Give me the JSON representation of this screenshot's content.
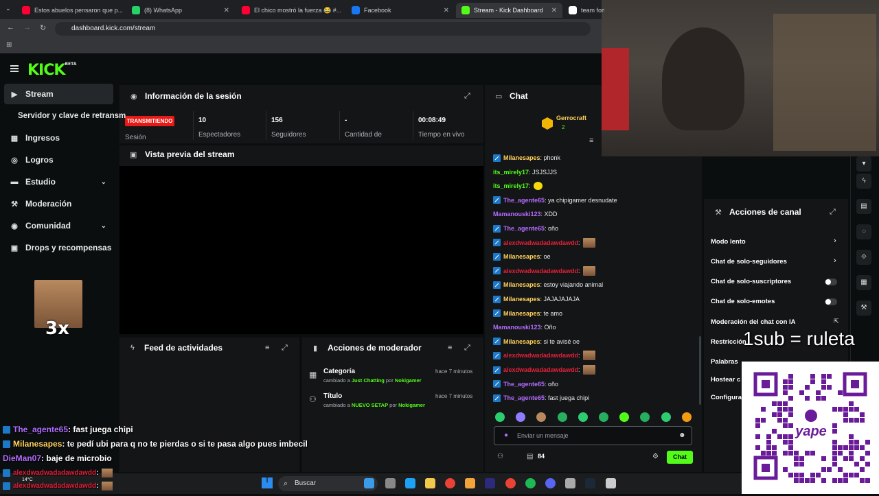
{
  "browser": {
    "tabs": [
      {
        "title": "Estos abuelos pensaron que p...",
        "color": "#ff0033"
      },
      {
        "title": "(8) WhatsApp",
        "color": "#25d366"
      },
      {
        "title": "El chico mostró la fuerza 😂 #...",
        "color": "#ff0033"
      },
      {
        "title": "Facebook",
        "color": "#1877f2"
      },
      {
        "title": "Stream - Kick Dashboard",
        "color": "#53fc18"
      },
      {
        "title": "team fort",
        "color": "#ffffff"
      }
    ],
    "url": "dashboard.kick.com/stream"
  },
  "kick": {
    "logo": "KICK",
    "logo_sup": "BETA"
  },
  "sidebar": {
    "items": [
      {
        "label": "Stream",
        "icon": "play-icon",
        "active": true
      },
      {
        "label": "Servidor y clave de retransm",
        "icon": "",
        "active": false
      },
      {
        "label": "Ingresos",
        "icon": "money-icon"
      },
      {
        "label": "Logros",
        "icon": "trophy-icon"
      },
      {
        "label": "Estudio",
        "icon": "studio-icon",
        "chev": "⌄"
      },
      {
        "label": "Moderación",
        "icon": "gavel-icon"
      },
      {
        "label": "Comunidad",
        "icon": "people-icon",
        "chev": "⌄"
      },
      {
        "label": "Drops y recompensas",
        "icon": "gift-icon"
      }
    ],
    "emote_text": "3x"
  },
  "session": {
    "title": "Información de la sesión",
    "badge": "TRANSMITIENDO",
    "badge_label": "Sesión",
    "stats": [
      {
        "value": "10",
        "label": "Espectadores"
      },
      {
        "value": "156",
        "label": "Seguidores"
      },
      {
        "value": "-",
        "label": "Cantidad de"
      },
      {
        "value": "00:08:49",
        "label": "Tiempo en vivo"
      }
    ]
  },
  "preview": {
    "title": "Vista previa del stream"
  },
  "feed": {
    "title": "Feed de actividades"
  },
  "mod_actions": {
    "title": "Acciones de moderador",
    "rows": [
      {
        "title": "Categoría",
        "prefix": "cambiado a",
        "value": "Just Chatting",
        "by": "por",
        "user": "Nokigamer",
        "time": "hace 7 minutos"
      },
      {
        "title": "Título",
        "prefix": "cambiado a",
        "value": "NUEVO SETAP",
        "by": "por",
        "user": "Nokigamer",
        "time": "hace 7 minutos"
      }
    ]
  },
  "chat": {
    "title": "Chat",
    "top_user": "Gerrocraft",
    "top_user_count": "2",
    "messages": [
      {
        "user": "Milanesapes",
        "text": ": phonk",
        "color": "#ffd35c",
        "badge": true
      },
      {
        "user": "its_mirely17",
        "text": ": JSJSJJS",
        "color": "#53fc18",
        "badge": false
      },
      {
        "user": "its_mirely17",
        "text": ":",
        "color": "#53fc18",
        "badge": false,
        "yellow": true
      },
      {
        "user": "The_agente65",
        "text": ": ya chipigamer desnudate",
        "color": "#b36cff",
        "badge": true
      },
      {
        "user": "Mamanouski123",
        "text": ": XDD",
        "color": "#b36cff",
        "badge": false
      },
      {
        "user": "The_agente65",
        "text": ": oño",
        "color": "#b36cff",
        "badge": true
      },
      {
        "user": "alexdwadwadadawdawdd",
        "text": ":",
        "color": "#e4203a",
        "badge": true,
        "emote": true
      },
      {
        "user": "Milanesapes",
        "text": ": oe",
        "color": "#ffd35c",
        "badge": true
      },
      {
        "user": "alexdwadwadadawdawdd",
        "text": ":",
        "color": "#e4203a",
        "badge": true,
        "emote": true
      },
      {
        "user": "Milanesapes",
        "text": ": estoy viajando animal",
        "color": "#ffd35c",
        "badge": true
      },
      {
        "user": "Milanesapes",
        "text": ": JAJAJAJAJA",
        "color": "#ffd35c",
        "badge": true
      },
      {
        "user": "Milanesapes",
        "text": ": te amo",
        "color": "#ffd35c",
        "badge": true
      },
      {
        "user": "Mamanouski123",
        "text": ": Oño",
        "color": "#b36cff",
        "badge": false
      },
      {
        "user": "Milanesapes",
        "text": ": si te avisé oe",
        "color": "#ffd35c",
        "badge": true
      },
      {
        "user": "alexdwadwadadawdawdd",
        "text": ":",
        "color": "#e4203a",
        "badge": true,
        "emote": true
      },
      {
        "user": "alexdwadwadadawdawdd",
        "text": ":",
        "color": "#e4203a",
        "badge": true,
        "emote": true
      },
      {
        "user": "The_agente65",
        "text": ": oño",
        "color": "#b36cff",
        "badge": true
      },
      {
        "user": "The_agente65",
        "text": ": fast juega chipi",
        "color": "#b36cff",
        "badge": true
      }
    ],
    "input_placeholder": "Enviar un mensaje",
    "viewer_count": "84",
    "send_label": "Chat"
  },
  "channel_actions": {
    "title": "Acciones de canal",
    "rows": [
      {
        "label": "Modo lento",
        "control": "chevron"
      },
      {
        "label": "Chat de solo-seguidores",
        "control": "chevron"
      },
      {
        "label": "Chat de solo-suscriptores",
        "control": "toggle"
      },
      {
        "label": "Chat de solo-emotes",
        "control": "toggle"
      },
      {
        "label": "Moderación del chat con IA",
        "control": "external"
      },
      {
        "label": "Restricción",
        "control": "none"
      },
      {
        "label": "Palabras",
        "control": "none"
      },
      {
        "label": "Hostear c",
        "control": "none"
      },
      {
        "label": "Configura",
        "control": "none"
      }
    ]
  },
  "overlay": {
    "text": "1sub = ruleta",
    "qr_brand": "yape",
    "chat": [
      {
        "user": "The_agente65",
        "text": ": fast juega chipi",
        "color": "#b36cff",
        "badge": true
      },
      {
        "user": "Milanesapes",
        "text": ": te pedí ubi para q no te pierdas o si te pasa algo pues imbecil",
        "color": "#ffd35c",
        "badge": true
      },
      {
        "user": "DieMan07",
        "text": ": baje de microbio",
        "color": "#b36cff",
        "badge": false
      },
      {
        "user": "alexdwadwadadawdawdd",
        "text": ":",
        "color": "#e4203a",
        "badge": true,
        "emote": true
      },
      {
        "user": "alexdwadwadadawdawdd",
        "text": ":",
        "color": "#e4203a",
        "badge": true,
        "emote": true
      }
    ]
  },
  "taskbar": {
    "search_label": "Buscar",
    "weather": "14°C"
  }
}
